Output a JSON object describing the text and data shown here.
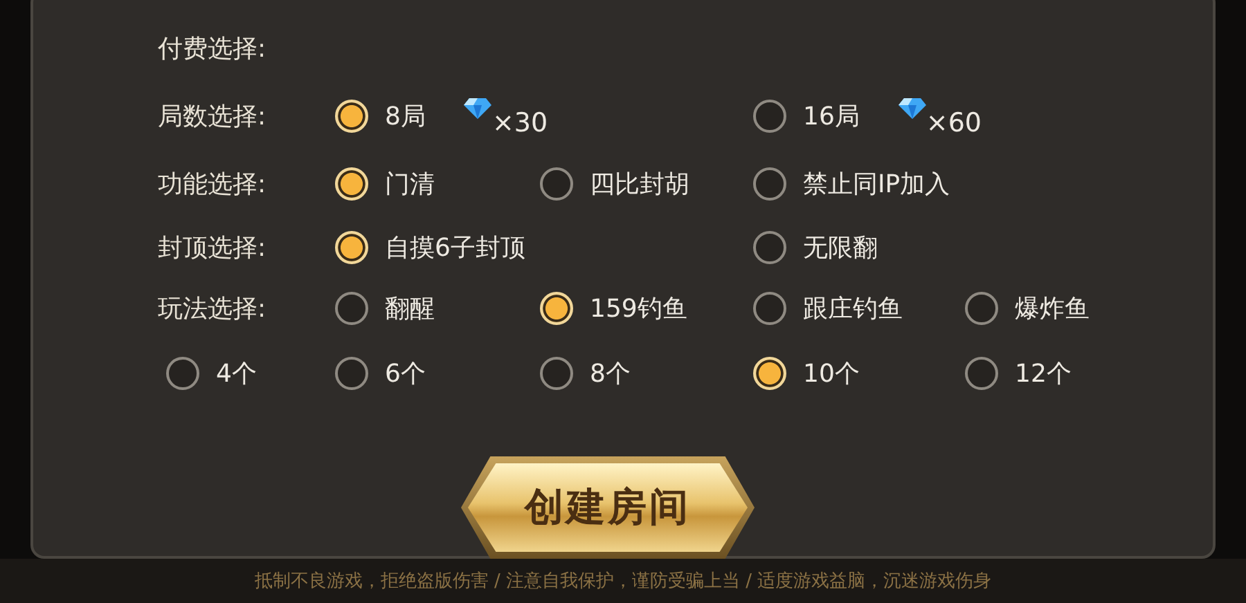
{
  "rows": [
    {
      "label": "付费选择:",
      "options": []
    },
    {
      "label": "局数选择:",
      "options": [
        {
          "label": "8局",
          "selected": true,
          "cost": "×30"
        },
        {
          "label": "16局",
          "selected": false,
          "cost": "×60"
        }
      ]
    },
    {
      "label": "功能选择:",
      "options": [
        {
          "label": "门清",
          "selected": true
        },
        {
          "label": "四比封胡",
          "selected": false
        },
        {
          "label": "禁止同IP加入",
          "selected": false
        }
      ]
    },
    {
      "label": "封顶选择:",
      "options": [
        {
          "label": "自摸6子封顶",
          "selected": true
        },
        {
          "label": "无限翻",
          "selected": false
        }
      ]
    },
    {
      "label": "玩法选择:",
      "options": [
        {
          "label": "翻醒",
          "selected": false
        },
        {
          "label": "159钓鱼",
          "selected": true
        },
        {
          "label": "跟庄钓鱼",
          "selected": false
        },
        {
          "label": "爆炸鱼",
          "selected": false
        }
      ]
    },
    {
      "options": [
        {
          "label": "4个",
          "selected": false
        },
        {
          "label": "6个",
          "selected": false
        },
        {
          "label": "8个",
          "selected": false
        },
        {
          "label": "10个",
          "selected": true
        },
        {
          "label": "12个",
          "selected": false
        }
      ]
    }
  ],
  "create_button": "创建房间",
  "footer": "抵制不良游戏，拒绝盗版伤害 / 注意自我保护，谨防受骗上当 / 适度游戏益脑，沉迷游戏伤身"
}
